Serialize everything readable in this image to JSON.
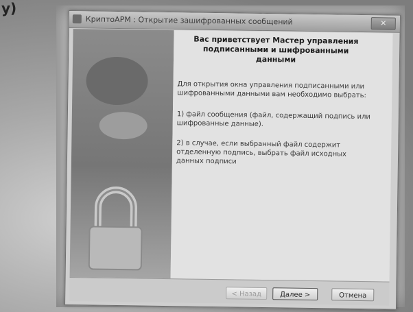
{
  "corner_mark": "y)",
  "window": {
    "title": "КриптоАРМ : Открытие зашифрованных сообщений",
    "close_symbol": "✕"
  },
  "wizard": {
    "welcome_title": "Вас приветствует Мастер управления подписанными и шифрованными данными",
    "intro": "Для открытия окна управления подписанными или шифрованными данными вам необходимо выбрать:",
    "step1": "1) файл сообщения (файл, содержащий подпись или шифрованные данные).",
    "step2": "2) в случае, если выбранный файл содержит отделенную подпись, выбрать файл исходных данных подписи"
  },
  "buttons": {
    "back": "< Назад",
    "next": "Далее >",
    "cancel": "Отмена"
  },
  "icons": {
    "app": "cryptoarm-app-icon",
    "lock": "padlock-icon"
  }
}
